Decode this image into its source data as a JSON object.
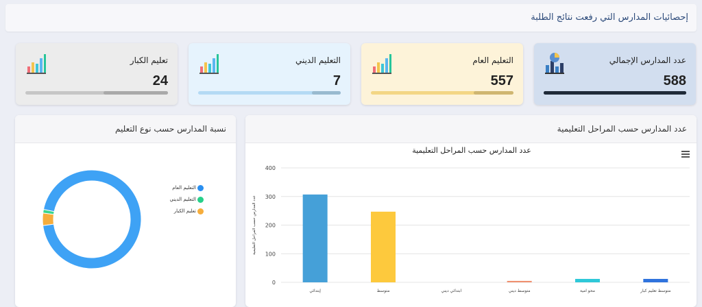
{
  "header": {
    "title": "إحصائيات المدارس التي رفعت نتائج الطلبة"
  },
  "cards": [
    {
      "title": "عدد المدارس الإجمالي",
      "value": "588",
      "bg": "#d2deef",
      "bar_color": "#1f2f46",
      "fill": 1.0
    },
    {
      "title": "التعليم العام",
      "value": "557",
      "bg": "#fdf3d9",
      "bar_color": "#f3cc5e",
      "fill": 0.28
    },
    {
      "title": "التعليم الديني",
      "value": "7",
      "bg": "#e6f3fd",
      "bar_color": "#9fd2f5",
      "fill": 0.2
    },
    {
      "title": "تعليم الكبار",
      "value": "24",
      "bg": "#ececec",
      "bar_color": "#bdbdbd",
      "fill": 0.45
    }
  ],
  "pie_panel": {
    "title": "نسبة المدارس حسب نوع التعليم",
    "legend": [
      {
        "label": "التعليم العام",
        "color": "#2a8ff0"
      },
      {
        "label": "التعليم الديني",
        "color": "#27d08a"
      },
      {
        "label": "تعليم الكبار",
        "color": "#f6ad3c"
      }
    ]
  },
  "bar_panel": {
    "title": "عدد المدارس حسب المراحل التعليمية",
    "menu_icon": "hamburger-icon"
  },
  "chart_data": [
    {
      "type": "pie",
      "categories": [
        "التعليم العام",
        "التعليم الديني",
        "تعليم الكبار"
      ],
      "values": [
        557,
        7,
        24
      ],
      "colors": [
        "#3ea2f5",
        "#3ad68f",
        "#f6ad3c"
      ],
      "donut": true
    },
    {
      "type": "bar",
      "title": "عدد المدارس حسب المراحل التعليمية",
      "ylabel": "عدد المدارس حسب المراحل التعليمية",
      "categories": [
        "إبتدائي",
        "متوسط",
        "ابتدائي ديني",
        "متوسط ديني",
        "محو امية",
        "متوسط تعليم كبار"
      ],
      "values": [
        307,
        247,
        0,
        5,
        12,
        12
      ],
      "colors": [
        "#45a0d8",
        "#fdc93d",
        "#45a0d8",
        "#ef8f6e",
        "#2ec8d8",
        "#2f73dd"
      ],
      "ylim": [
        0,
        400
      ],
      "yticks": [
        0,
        100,
        200,
        300,
        400
      ],
      "grid": true
    }
  ]
}
